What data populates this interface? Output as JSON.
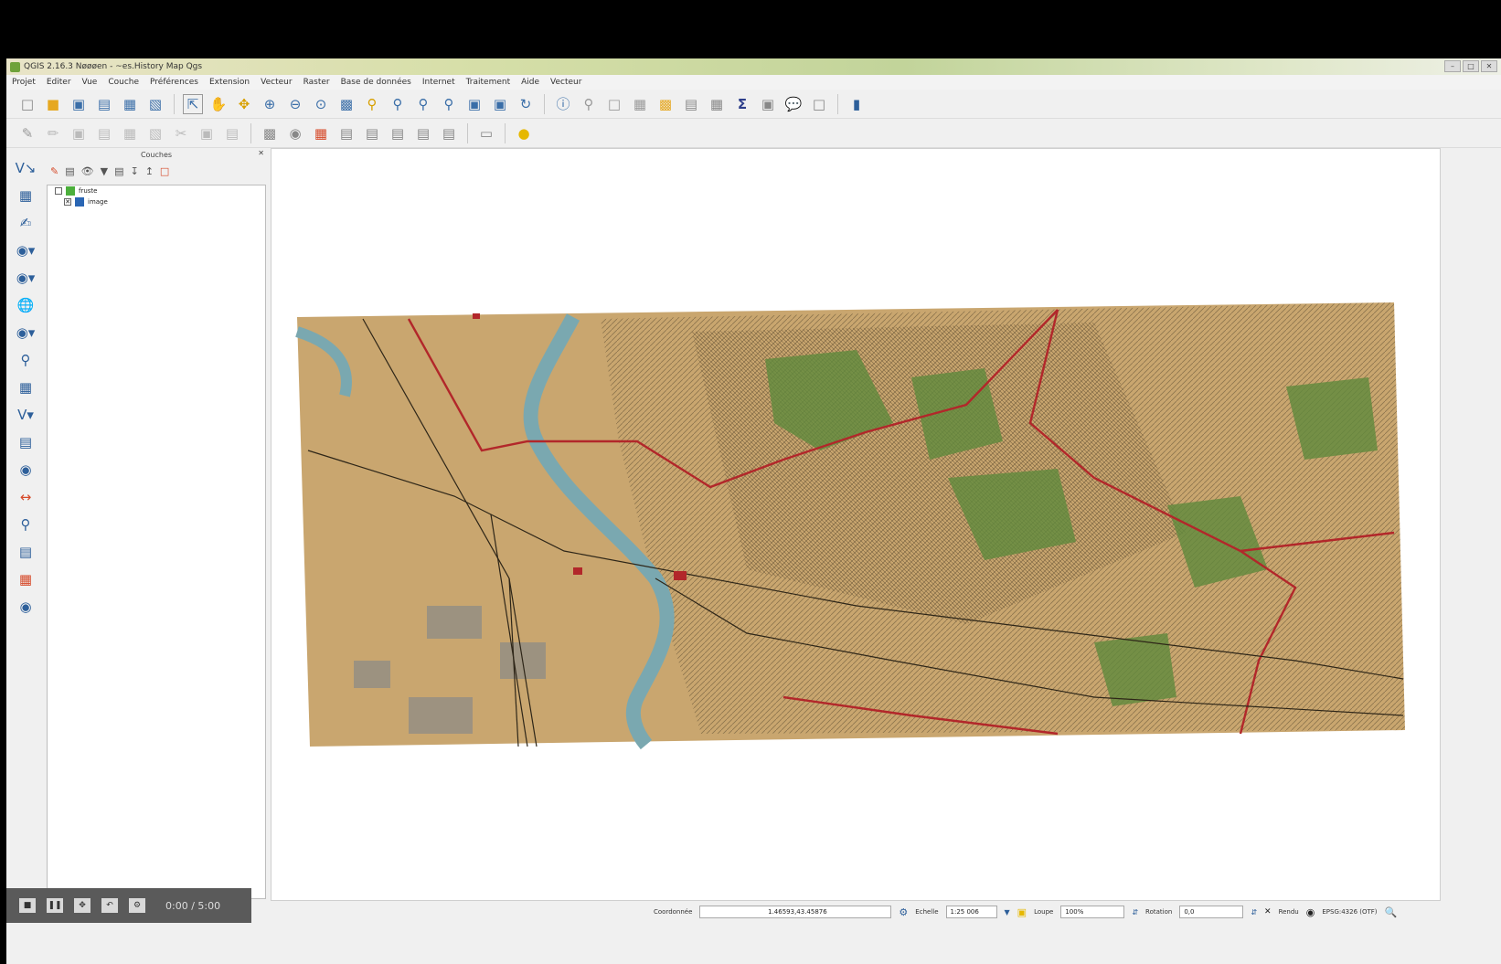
{
  "window": {
    "title": "QGIS 2.16.3 Nøøøen - ~es.History Map Qgs",
    "controls": [
      "–",
      "□",
      "✕"
    ]
  },
  "menubar": {
    "items": [
      "Projet",
      "Editer",
      "Vue",
      "Couche",
      "Préférences",
      "Extension",
      "Vecteur",
      "Raster",
      "Base de données",
      "Internet",
      "Traitement",
      "Aide",
      "Vecteur"
    ]
  },
  "toolbar1": {
    "icons": [
      "new-project-icon",
      "open-project-icon",
      "save-project-icon",
      "save-as-icon",
      "new-print-composer-icon",
      "composer-manager-icon",
      "pan-to-selection-icon",
      "pan-icon",
      "pan-map-icon",
      "zoom-in-icon",
      "zoom-out-icon",
      "zoom-full-icon",
      "zoom-layer-icon",
      "zoom-selection-icon",
      "zoom-last-icon",
      "zoom-next-icon",
      "zoom-native-icon",
      "new-map-view-icon",
      "new-bookmark-icon",
      "refresh-icon",
      "identify-icon",
      "select-features-icon",
      "deselect-icon",
      "measure-icon",
      "attribute-table-icon",
      "statistics-icon",
      "sum-icon",
      "field-calculator-icon",
      "tips-icon",
      "annotation-icon",
      "help-icon"
    ]
  },
  "toolbar2": {
    "icons": [
      "edit-pencil-icon",
      "toggle-editing-icon",
      "save-edits-icon",
      "add-feature-icon",
      "node-tool-icon",
      "delete-icon",
      "cut-icon",
      "copy-icon",
      "paste-icon",
      "label-icon",
      "pin-icon",
      "raster-icon",
      "layer-style-icon",
      "diagram-icon",
      "move-label-icon",
      "rotate-label-icon",
      "change-label-icon",
      "map-tips-icon",
      "python-icon"
    ]
  },
  "lefttools": {
    "icons": [
      "add-vector-layer-icon",
      "add-raster-layer-icon",
      "add-delimited-text-icon",
      "add-spatialite-icon",
      "add-postgis-icon",
      "add-wms-icon",
      "add-wcs-icon",
      "add-wfs-icon",
      "add-mssql-icon",
      "add-virtual-layer-icon",
      "new-shapefile-icon",
      "new-spatialite-icon",
      "add-oracle-icon",
      "digitize-icon",
      "add-gps-icon",
      "gps-tool-icon",
      "georeferencer-icon",
      "plugins-icon"
    ]
  },
  "layers": {
    "title": "Couches",
    "close_label": "✕",
    "items": [
      {
        "label": "fruste",
        "color": "#4caf3c",
        "checked": false
      },
      {
        "label": "image",
        "color": "#2a66b4",
        "checked": true
      }
    ]
  },
  "playbar": {
    "time": "0:00 / 5:00"
  },
  "statusbar": {
    "coord_label": "Coordonnée",
    "coord_value": "1.46593,43.45876",
    "scale_label": "Echelle",
    "scale_value": "1:25 006",
    "mag_label": "Loupe",
    "mag_value": "100%",
    "rotation_label": "Rotation",
    "rotation_value": "0,0",
    "render_label": "Rendu",
    "crs_label": "EPSG:4326 (OTF)"
  },
  "colors": {
    "map_paper": "#c9a66f",
    "forest": "#5f8a3c",
    "river": "#7aa8b0",
    "boundary": "#b2272a"
  }
}
